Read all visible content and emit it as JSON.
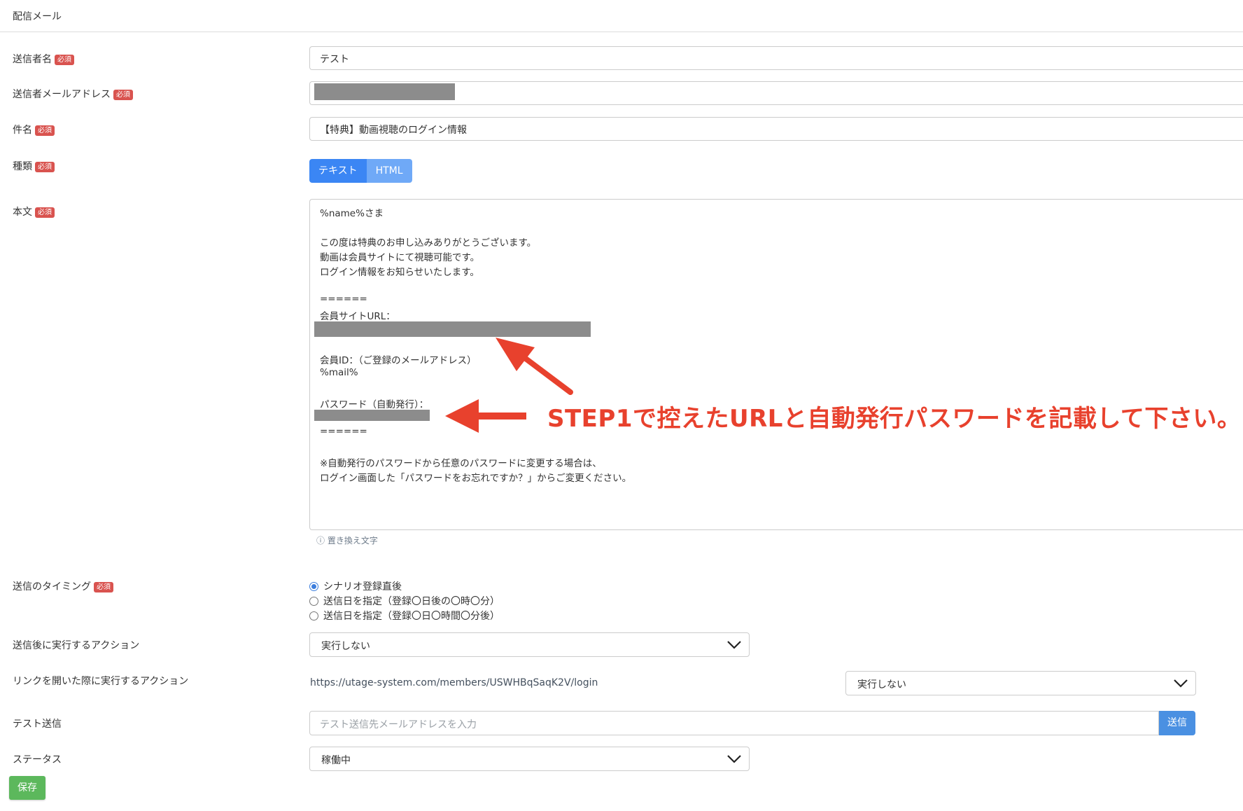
{
  "header": {
    "title": "配信メール"
  },
  "required_badge": "必須",
  "fields": {
    "sender_name": {
      "label": "送信者名",
      "value": "テスト"
    },
    "sender_email": {
      "label": "送信者メールアドレス"
    },
    "subject": {
      "label": "件名",
      "value": "【特典】動画視聴のログイン情報"
    },
    "type": {
      "label": "種類",
      "options": [
        "テキスト",
        "HTML"
      ],
      "selected": "テキスト"
    },
    "body": {
      "label": "本文",
      "lines": [
        "%name%さま",
        "",
        "この度は特典のお申し込みありがとうございます。",
        "動画は会員サイトにて視聴可能です。",
        "ログイン情報をお知らせいたします。",
        "",
        "======",
        "会員サイトURL：",
        "",
        "",
        "会員ID：（ご登録のメールアドレス）",
        "%mail%",
        "",
        "パスワード（自動発行）：",
        "",
        "======",
        "",
        "※自動発行のパスワードから任意のパスワードに変更する場合は、",
        "ログイン画面した「パスワードをお忘れですか？」からご変更ください。"
      ],
      "hint": "ⓘ 置き換え文字"
    },
    "timing": {
      "label": "送信のタイミング",
      "options": [
        "シナリオ登録直後",
        "送信日を指定（登録〇日後の〇時〇分）",
        "送信日を指定（登録〇日〇時間〇分後）"
      ],
      "selected": "シナリオ登録直後"
    },
    "after_action": {
      "label": "送信後に実行するアクション",
      "value": "実行しない"
    },
    "link_action": {
      "label": "リンクを開いた際に実行するアクション",
      "url": "https://utage-system.com/members/USWHBqSaqK2V/login",
      "value": "実行しない"
    },
    "test_send": {
      "label": "テスト送信",
      "placeholder": "テスト送信先メールアドレスを入力",
      "button": "送信"
    },
    "status": {
      "label": "ステータス",
      "value": "稼働中"
    }
  },
  "annotation": {
    "text": "STEP1で控えたURLと自動発行パスワードを記載して下さい。",
    "color": "#e8412d"
  },
  "save_button": "保存",
  "colors": {
    "primary": "#3b86f4",
    "required": "#d9534f",
    "save": "#5cb85c",
    "annotation": "#e8412d"
  }
}
